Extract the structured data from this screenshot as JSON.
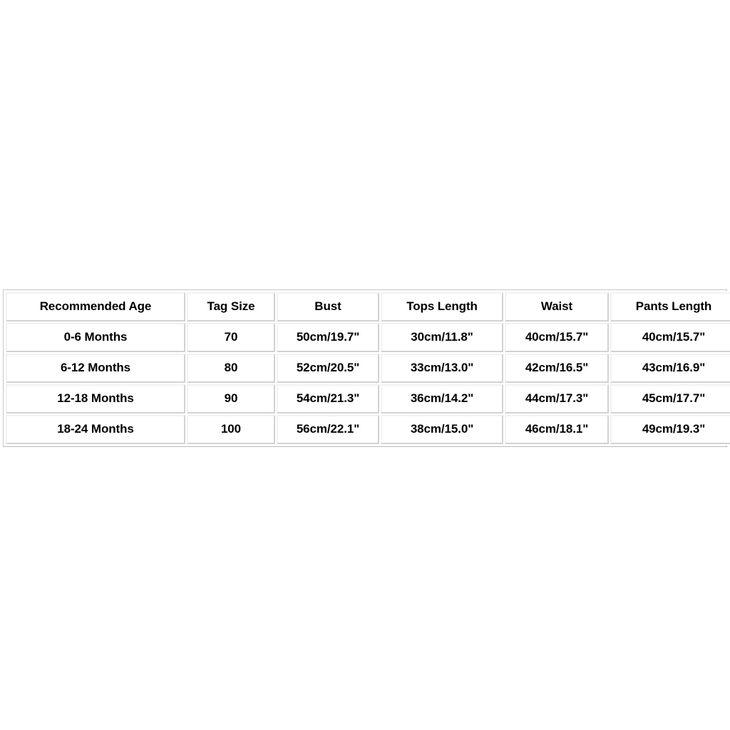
{
  "chart_data": {
    "type": "table",
    "title": "",
    "columns": [
      "Recommended Age",
      "Tag Size",
      "Bust",
      "Tops Length",
      "Waist",
      "Pants Length"
    ],
    "rows": [
      [
        "0-6 Months",
        "70",
        "50cm/19.7\"",
        "30cm/11.8\"",
        "40cm/15.7\"",
        "40cm/15.7\""
      ],
      [
        "6-12 Months",
        "80",
        "52cm/20.5\"",
        "33cm/13.0\"",
        "42cm/16.5\"",
        "43cm/16.9\""
      ],
      [
        "12-18 Months",
        "90",
        "54cm/21.3\"",
        "36cm/14.2\"",
        "44cm/17.3\"",
        "45cm/17.7\""
      ],
      [
        "18-24 Months",
        "100",
        "56cm/22.1\"",
        "38cm/15.0\"",
        "46cm/18.1\"",
        "49cm/19.3\""
      ]
    ]
  },
  "colors": {
    "page_background": "#ffffff",
    "cell_background": "#ffffff",
    "text": "#000000",
    "border_light": "#f2f2f2",
    "border_dark": "#d2d2d2",
    "table_outline": "#b9b9b9"
  }
}
